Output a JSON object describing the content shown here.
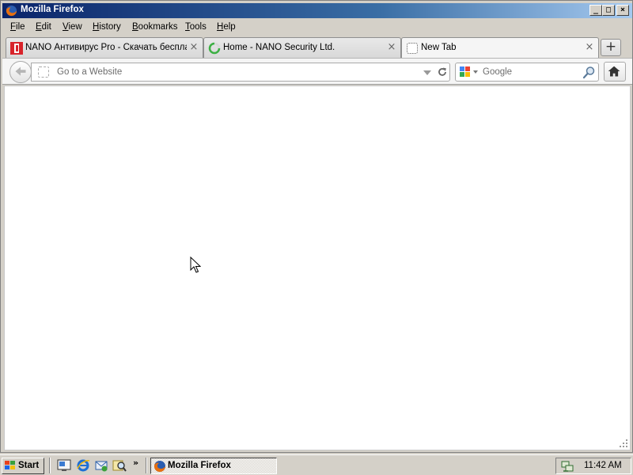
{
  "window": {
    "title": "Mozilla Firefox",
    "caption_buttons": {
      "minimize": "_",
      "maximize": "□",
      "close": "×"
    }
  },
  "menubar": {
    "items": [
      {
        "label": "File",
        "accel": "F",
        "rest": "ile"
      },
      {
        "label": "Edit",
        "accel": "E",
        "rest": "dit"
      },
      {
        "label": "View",
        "accel": "V",
        "rest": "iew"
      },
      {
        "label": "History",
        "accel": "H",
        "rest": "istory"
      },
      {
        "label": "Bookmarks",
        "accel": "B",
        "rest": "ookmarks"
      },
      {
        "label": "Tools",
        "accel": "T",
        "rest": "ools"
      },
      {
        "label": "Help",
        "accel": "H",
        "rest": "elp"
      }
    ]
  },
  "tabs": [
    {
      "label": "NANO Антивирус Pro - Скачать беспла...",
      "icon": "nano-favicon",
      "active": false
    },
    {
      "label": "Home - NANO Security Ltd.",
      "icon": "loading-spinner-icon",
      "active": false
    },
    {
      "label": "New Tab",
      "icon": "blank-page-icon",
      "active": true
    }
  ],
  "tab_close_glyph": "×",
  "new_tab_glyph": "+",
  "navbar": {
    "url_placeholder": "Go to a Website",
    "url_value": "",
    "search_placeholder": "Google",
    "search_engine": "google-icon"
  },
  "taskbar": {
    "start_label": "Start",
    "quick_launch_chevron": "»",
    "quick_launch": [
      "show-desktop-icon",
      "internet-explorer-icon",
      "outlook-express-icon",
      "search-icon"
    ],
    "tasks": [
      {
        "label": "Mozilla Firefox",
        "icon": "firefox-icon"
      }
    ],
    "clock": "11:42 AM"
  },
  "colors": {
    "titlebar_start": "#0a246a",
    "titlebar_end": "#a6caf0",
    "chrome": "#d4d0c8",
    "content": "#ffffff"
  }
}
